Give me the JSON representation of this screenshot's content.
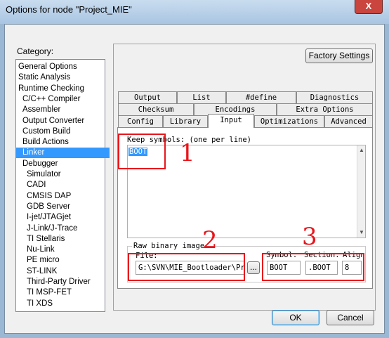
{
  "window": {
    "title": "Options for node \"Project_MIE\"",
    "close_label": "X"
  },
  "category": {
    "label": "Category:",
    "items": [
      {
        "label": "General Options",
        "indent": 0
      },
      {
        "label": "Static Analysis",
        "indent": 0
      },
      {
        "label": "Runtime Checking",
        "indent": 0
      },
      {
        "label": "C/C++ Compiler",
        "indent": 1
      },
      {
        "label": "Assembler",
        "indent": 1
      },
      {
        "label": "Output Converter",
        "indent": 1
      },
      {
        "label": "Custom Build",
        "indent": 1
      },
      {
        "label": "Build Actions",
        "indent": 1
      },
      {
        "label": "Linker",
        "indent": 1,
        "selected": true
      },
      {
        "label": "Debugger",
        "indent": 1
      },
      {
        "label": "Simulator",
        "indent": 2
      },
      {
        "label": "CADI",
        "indent": 2
      },
      {
        "label": "CMSIS DAP",
        "indent": 2
      },
      {
        "label": "GDB Server",
        "indent": 2
      },
      {
        "label": "I-jet/JTAGjet",
        "indent": 2
      },
      {
        "label": "J-Link/J-Trace",
        "indent": 2
      },
      {
        "label": "TI Stellaris",
        "indent": 2
      },
      {
        "label": "Nu-Link",
        "indent": 2
      },
      {
        "label": "PE micro",
        "indent": 2
      },
      {
        "label": "ST-LINK",
        "indent": 2
      },
      {
        "label": "Third-Party Driver",
        "indent": 2
      },
      {
        "label": "TI MSP-FET",
        "indent": 2
      },
      {
        "label": "TI XDS",
        "indent": 2
      }
    ]
  },
  "buttons": {
    "factory": "Factory Settings",
    "ok": "OK",
    "cancel": "Cancel",
    "browse": "..."
  },
  "tabs": {
    "row1": [
      "Output",
      "List",
      "#define",
      "Diagnostics"
    ],
    "row2": [
      "Checksum",
      "Encodings",
      "Extra Options"
    ],
    "row3": [
      "Config",
      "Library",
      "Input",
      "Optimizations",
      "Advanced"
    ],
    "active": "Input"
  },
  "input_tab": {
    "keep_symbols_label": "Keep symbols: (one per line)",
    "keep_symbols_value": "BOOT",
    "raw_binary_label": "Raw binary image",
    "file_label": "File:",
    "file_value": "G:\\SVN\\MIE_Bootloader\\Proj",
    "symbol_label": "Symbol:",
    "symbol_value": "BOOT",
    "section_label": "Section:",
    "section_value": ".BOOT",
    "align_label": "Align",
    "align_value": "8"
  },
  "annotations": [
    "1",
    "2",
    "3"
  ]
}
